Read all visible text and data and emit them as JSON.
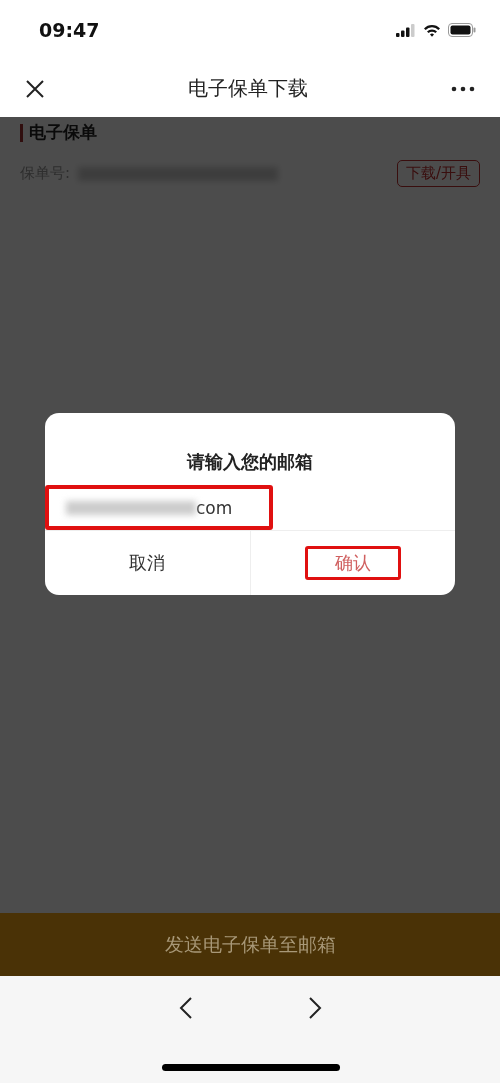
{
  "status_bar": {
    "time": "09:47"
  },
  "nav": {
    "title": "电子保单下载"
  },
  "section": {
    "title": "电子保单",
    "policy_label": "保单号:",
    "policy_number_redacted": true,
    "action_button": "下载/开具"
  },
  "primary_button": {
    "label": "发送电子保单至邮箱"
  },
  "overlay": {
    "dimmed": true
  },
  "dialog": {
    "title": "请输入您的邮箱",
    "email_field": {
      "value": "com",
      "redacted_prefix": true,
      "highlighted": true
    },
    "buttons": [
      {
        "label": "取消",
        "kind": "cancel",
        "highlighted": false
      },
      {
        "label": "确认",
        "kind": "confirm",
        "highlighted": true
      }
    ]
  }
}
